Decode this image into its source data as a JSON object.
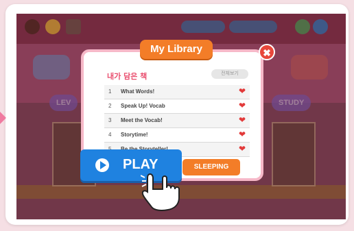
{
  "modal": {
    "title": "My Library",
    "subtitle": "내가 담은 책",
    "filter_label": "전체보기",
    "close_glyph": "✖",
    "items": [
      {
        "num": "1",
        "title": "What Words!"
      },
      {
        "num": "2",
        "title": "Speak Up! Vocab"
      },
      {
        "num": "3",
        "title": "Meet the Vocab!"
      },
      {
        "num": "4",
        "title": "Storytime!"
      },
      {
        "num": "5",
        "title": "Be the Storyteller!"
      }
    ]
  },
  "buttons": {
    "play_label": "PLAY",
    "sleeping_label": "SLEEPING",
    "heart_glyph": "❤"
  },
  "background": {
    "left_label": "LEV",
    "right_label": "STUDY"
  },
  "colors": {
    "accent_orange": "#f37d28",
    "play_blue": "#1f82e0",
    "heart_red": "#e23a3a",
    "subtitle_pink": "#e94d6d"
  }
}
